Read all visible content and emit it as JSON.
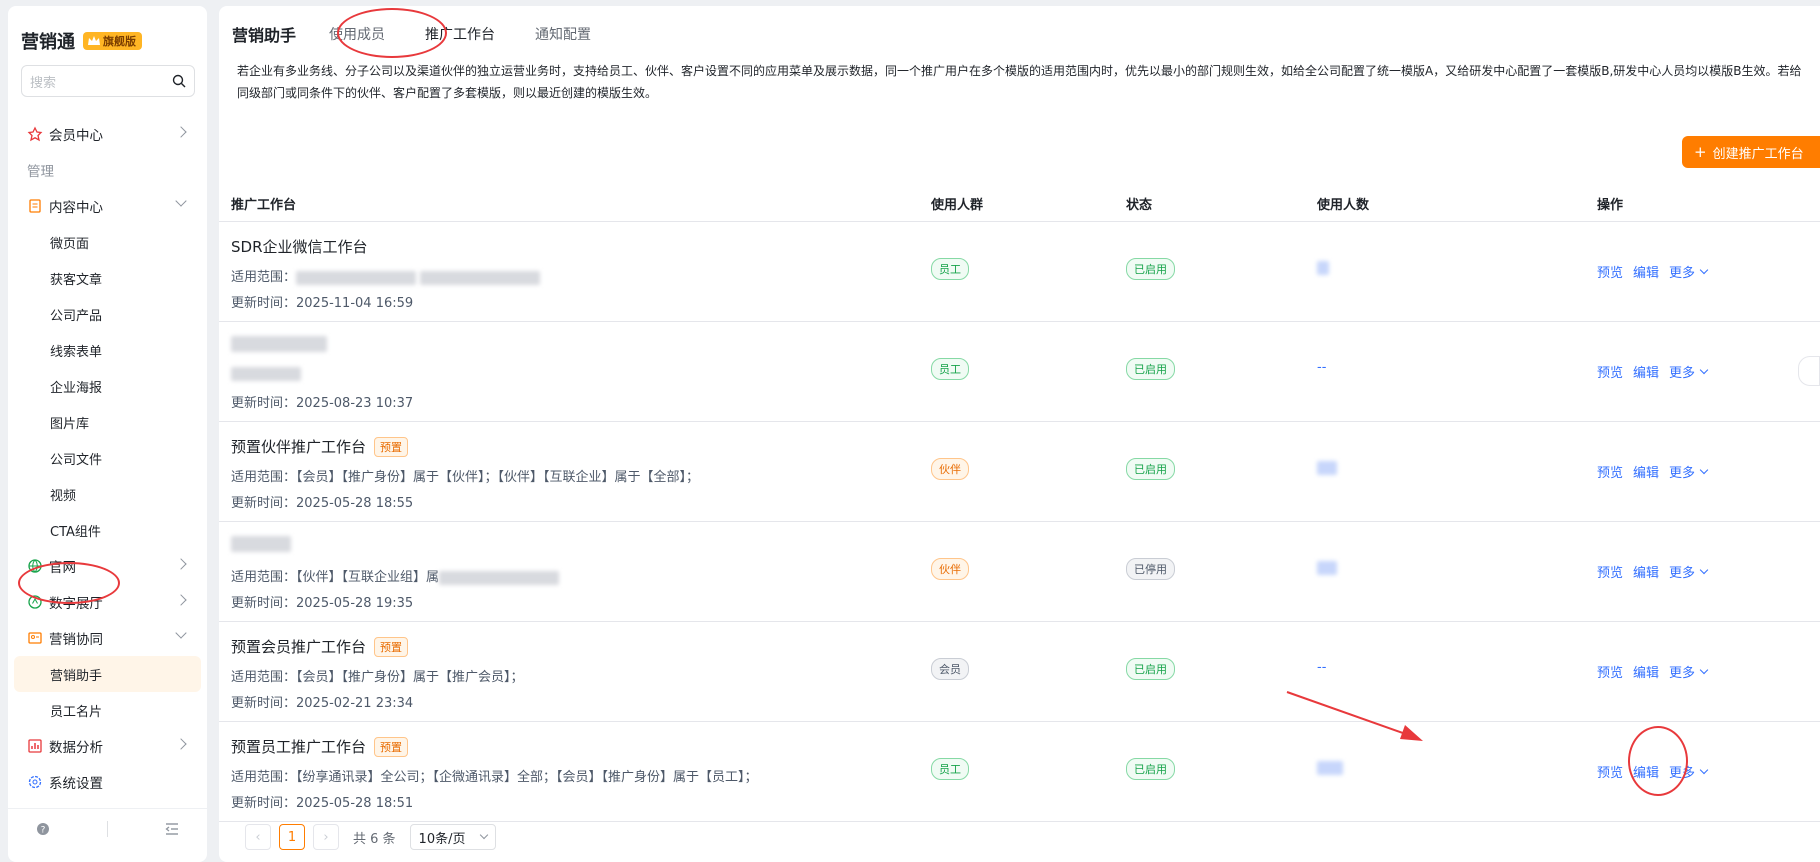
{
  "app": {
    "name": "营销通",
    "edition": "旗舰版"
  },
  "search": {
    "placeholder": "搜索"
  },
  "nav": {
    "member_center": "会员中心",
    "group_manage": "管理",
    "content_center": "内容中心",
    "content_items": [
      "微页面",
      "获客文章",
      "公司产品",
      "线索表单",
      "企业海报",
      "图片库",
      "公司文件",
      "视频",
      "CTA组件"
    ],
    "website": "官网",
    "digital_hall": "数字展厅",
    "marketing_collab": "营销协同",
    "collab_items": [
      "营销助手",
      "员工名片"
    ],
    "data_analysis": "数据分析",
    "system_settings": "系统设置"
  },
  "tabs": {
    "title": "营销助手",
    "items": [
      "使用成员",
      "推广工作台",
      "通知配置"
    ],
    "active": "推广工作台"
  },
  "notice": "若企业有多业务线、分子公司以及渠道伙伴的独立运营业务时，支持给员工、伙伴、客户设置不同的应用菜单及展示数据，同一个推广用户在多个模版的适用范围内时，优先以最小的部门规则生效，如给全公司配置了统一模版A，又给研发中心配置了一套模版B,研发中心人员均以模版B生效。若给同级部门或同条件下的伙伴、客户配置了多套模版，则以最近创建的模版生效。",
  "create_button": "创建推广工作台",
  "table": {
    "headers": {
      "name": "推广工作台",
      "group": "使用人群",
      "status": "状态",
      "count": "使用人数",
      "ops": "操作"
    },
    "scope_prefix": "适用范围：",
    "time_prefix": "更新时间：",
    "ops": {
      "preview": "预览",
      "edit": "编辑",
      "more": "更多"
    },
    "preset_tag": "预置",
    "rows": [
      {
        "name": "SDR企业微信工作台",
        "scope": "",
        "time": "2025-11-04 16:59",
        "group": "员工",
        "status": "已启用",
        "count": ""
      },
      {
        "name": "",
        "scope": "",
        "time": "2025-08-23 10:37",
        "group": "员工",
        "status": "已启用",
        "count": "--"
      },
      {
        "name": "预置伙伴推广工作台",
        "scope": "【会员】【推广身份】属于【伙伴】；【伙伴】【互联企业】属于【全部】；",
        "time": "2025-05-28 18:55",
        "group": "伙伴",
        "status": "已启用",
        "count": ""
      },
      {
        "name": "",
        "scope": "【伙伴】【互联企业组】属",
        "time": "2025-05-28 19:35",
        "group": "伙伴",
        "status": "已停用",
        "count": ""
      },
      {
        "name": "预置会员推广工作台",
        "scope": "【会员】【推广身份】属于【推广会员】；",
        "time": "2025-02-21 23:34",
        "group": "会员",
        "status": "已启用",
        "count": "--"
      },
      {
        "name": "预置员工推广工作台",
        "scope": "【纷享通讯录】全公司；【企微通讯录】全部；【会员】【推广身份】属于【员工】；",
        "time": "2025-05-28 18:51",
        "group": "员工",
        "status": "已启用",
        "count": ""
      }
    ]
  },
  "pager": {
    "prev": "‹",
    "current": "1",
    "next": "›",
    "total": "共 6 条",
    "size": "10条/页"
  },
  "colors": {
    "accent": "#ff7d00",
    "link": "#3370ff",
    "annotation": "#e8393c"
  }
}
